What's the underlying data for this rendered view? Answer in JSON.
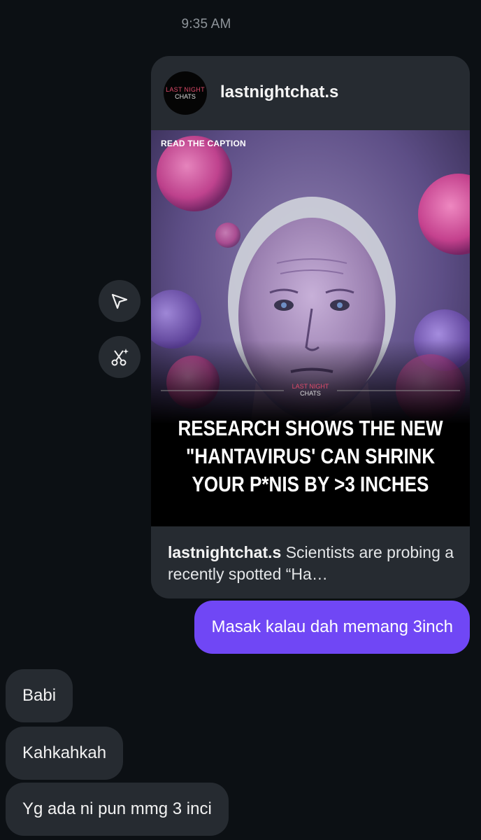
{
  "timestamp": "9:35 AM",
  "shared_post": {
    "avatar_text_line1": "LAST NIGHT",
    "avatar_text_line2": "CHATS",
    "username": "lastnightchat.s",
    "image": {
      "top_label": "READ THE CAPTION",
      "logo_line1": "LAST NIGHT",
      "logo_line2": "CHATS",
      "headline_lines": [
        "RESEARCH SHOWS THE NEW",
        "\"HANTAVIRUS' CAN SHRINK",
        "YOUR P*NIS BY >3 INCHES"
      ]
    },
    "caption_username": "lastnightchat.s",
    "caption_text": " Scientists are probing a recently spotted “Ha…"
  },
  "actions": {
    "share_icon": "send-icon",
    "ai_icon": "scissors-sparkle-icon"
  },
  "messages": [
    {
      "sender": "me",
      "text": "Masak kalau dah memang 3inch"
    },
    {
      "sender": "other",
      "text": "Babi"
    },
    {
      "sender": "other",
      "text": "Kahkahkah"
    },
    {
      "sender": "other",
      "text": "Yg ada ni pun mmg 3 inci"
    }
  ],
  "colors": {
    "background": "#0c1014",
    "bubble_received": "#262b31",
    "bubble_sent": "#7047f5"
  }
}
